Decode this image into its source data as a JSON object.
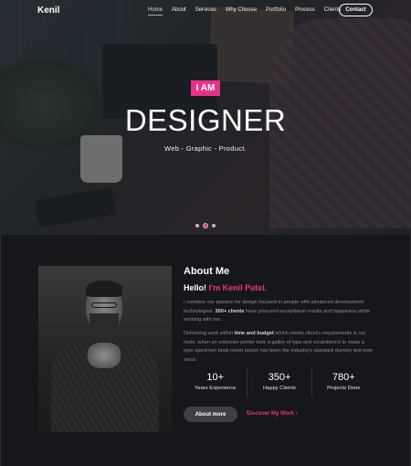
{
  "brand": {
    "logo": "Kenil"
  },
  "nav": {
    "items": [
      {
        "label": "Home",
        "active": true
      },
      {
        "label": "About",
        "active": false
      },
      {
        "label": "Services",
        "active": false
      },
      {
        "label": "Why Choose",
        "active": false
      },
      {
        "label": "Portfolio",
        "active": false
      },
      {
        "label": "Process",
        "active": false
      },
      {
        "label": "Clients",
        "active": false
      }
    ],
    "contact_label": "Contact"
  },
  "hero": {
    "badge": "I AM",
    "headline": "DESIGNER",
    "tagline": "Web  -  Graphic  -  Product.",
    "slides": 3,
    "active_slide": 2
  },
  "about": {
    "title": "About Me",
    "hello_prefix": "Hello!",
    "hello_name": "I'm Kenil Patel.",
    "para1_a": "I combine our passion for design focused in people with advanced development technologies.",
    "para1_bold": "350+ clients",
    "para1_b": "have procured exceptional results and happiness while working with me.",
    "para2_a": "Delivering work within",
    "para2_bold": "time and budget",
    "para2_b": "which meets client's requirements is our moto. when an unknown printer took a galley of type and scrambled it to make a type specimen book lorem Ipsum has been the industry's standard dummy text ever since.",
    "stats": [
      {
        "value": "10+",
        "label": "Years Experience"
      },
      {
        "value": "350+",
        "label": "Happy Clients"
      },
      {
        "value": "780+",
        "label": "Projects Done"
      }
    ],
    "more_label": "About more",
    "discover_label": "Discover My Work  ›"
  },
  "colors": {
    "accent": "#e8328a",
    "background": "#15171a"
  }
}
